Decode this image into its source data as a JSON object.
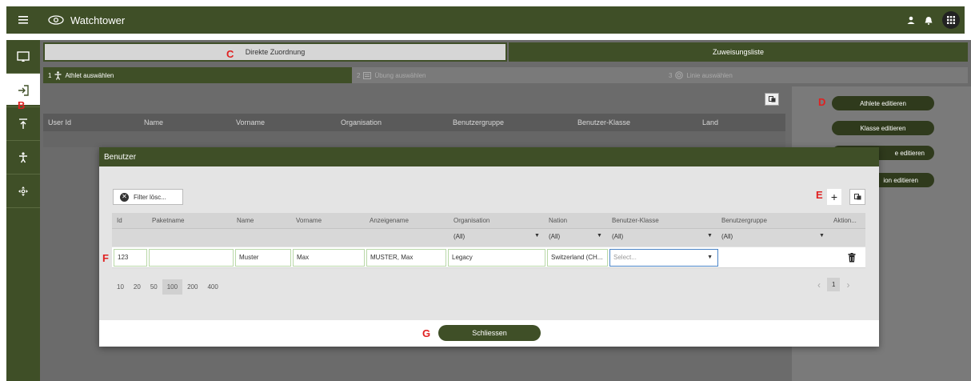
{
  "app": {
    "title": "Watchtower"
  },
  "tabs": [
    {
      "label": "Direkte Zuordnung"
    },
    {
      "label": "Zuweisungsliste"
    }
  ],
  "steps": [
    {
      "number": "1",
      "label": "Athlet auswählen",
      "icon": "athlete-icon"
    },
    {
      "number": "2",
      "label": "Übung auswählen",
      "icon": "list-icon"
    },
    {
      "number": "3",
      "label": "Linie auswählen",
      "icon": "target-icon"
    }
  ],
  "grid": {
    "columns": [
      "User Id",
      "Name",
      "Vorname",
      "Organisation",
      "Benutzergruppe",
      "Benutzer-Klasse",
      "Land"
    ]
  },
  "right_panel": {
    "buttons": [
      "Athlete editieren",
      "Klasse editieren",
      "e editieren",
      "ion editieren"
    ]
  },
  "annotations": {
    "B": "B",
    "C": "C",
    "D": "D",
    "E": "E",
    "F": "F",
    "G": "G"
  },
  "modal": {
    "title": "Benutzer",
    "filter_button": "Filter lösc...",
    "columns": [
      "Id",
      "Paketname",
      "Name",
      "Vorname",
      "Anzeigename",
      "Organisation",
      "Nation",
      "Benutzer-Klasse",
      "Benutzergruppe",
      "Aktion..."
    ],
    "filters": {
      "organisation": "(All)",
      "nation": "(All)",
      "klasse": "(All)",
      "gruppe": "(All)"
    },
    "row": {
      "id": "123",
      "paketname": "",
      "name": "Muster",
      "vorname": "Max",
      "anzeigename": "MUSTER, Max",
      "organisation": "Legacy",
      "nation": "Switzerland (CH...",
      "klasse_placeholder": "Select...",
      "gruppe": ""
    },
    "page_sizes": [
      "10",
      "20",
      "50",
      "100",
      "200",
      "400"
    ],
    "selected_page_size": "100",
    "current_page": "1",
    "close_button": "Schliessen"
  },
  "colors": {
    "brand": "#3f4f27",
    "overlay": "#6b6b6b",
    "annotation": "#e02020"
  }
}
